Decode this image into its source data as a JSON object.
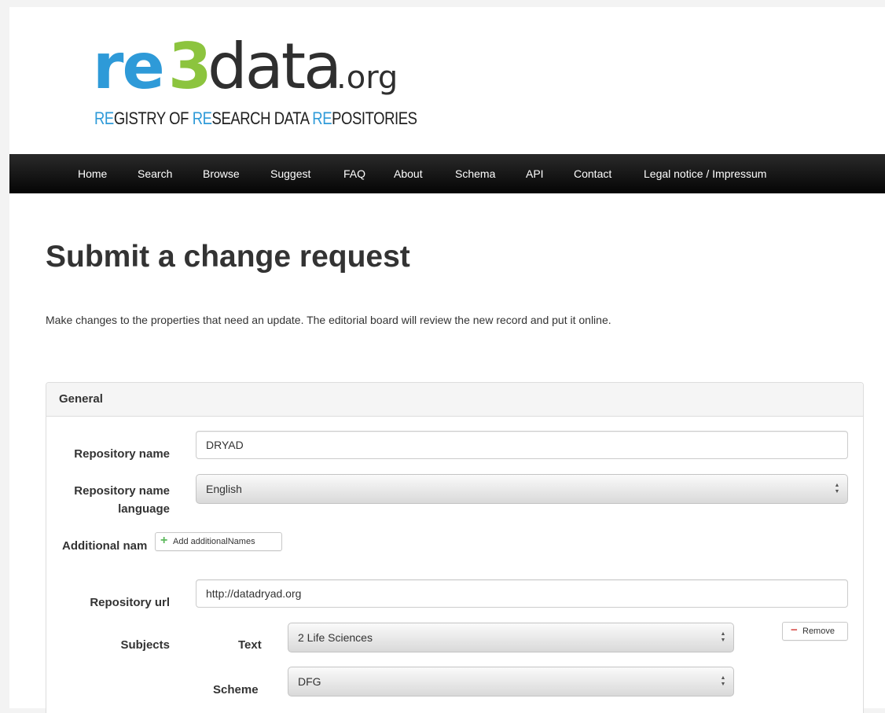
{
  "logo": {
    "re": "re",
    "three": "3",
    "data": "data",
    "org": ".org",
    "tagline_parts": [
      "RE",
      "GISTRY OF ",
      "RE",
      "SEARCH DATA ",
      "RE",
      "POSITORIES"
    ]
  },
  "nav": {
    "items": [
      "Home",
      "Search",
      "Browse",
      "Suggest",
      "FAQ",
      "About",
      "Schema",
      "API",
      "Contact",
      "Legal notice / Impressum"
    ]
  },
  "page": {
    "title": "Submit a change request",
    "intro": "Make changes to the properties that need an update. The editorial board will review the new record and put it online."
  },
  "panel": {
    "title": "General",
    "repository_name": {
      "label": "Repository name",
      "value": "DRYAD"
    },
    "repository_name_language": {
      "label_line1": "Repository name",
      "label_line2": "language",
      "value": "English"
    },
    "additional_names": {
      "label": "Additional nam",
      "button_label": "Add additionalNames"
    },
    "repository_url": {
      "label": "Repository url",
      "value": "http://datadryad.org"
    },
    "subjects": {
      "label": "Subjects",
      "text_label": "Text",
      "text_value": "2 Life Sciences",
      "scheme_label": "Scheme",
      "scheme_value": "DFG",
      "remove_label": "Remove"
    }
  },
  "icons": {
    "add": "plus-icon",
    "remove": "minus-icon",
    "select_arrows": "up-down-arrows-icon"
  },
  "colors": {
    "brand_blue": "#2e9ad8",
    "brand_green": "#8cc43e",
    "navbar": "#111111",
    "add_icon": "#5cb85c",
    "remove_icon": "#d9534f"
  }
}
